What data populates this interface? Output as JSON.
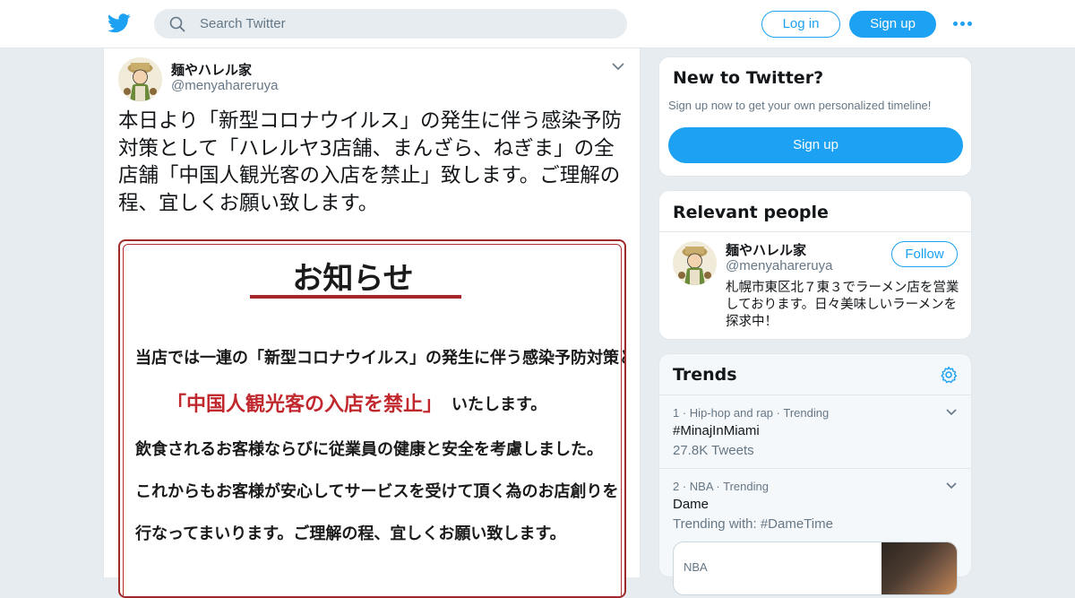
{
  "header": {
    "search_placeholder": "Search Twitter",
    "login_label": "Log in",
    "signup_label": "Sign up",
    "brand_color": "#1da1f2"
  },
  "tweet": {
    "author_name": "麺やハレル家",
    "author_handle": "@menyahareruya",
    "text": "本日より「新型コロナウイルス」の発生に伴う感染予防対策として「ハレルヤ3店舗、まんざら、ねぎま」の全店舗「中国人観光客の入店を禁止」致します。ご理解の程、宜しくお願い致します。",
    "image": {
      "title": "お知らせ",
      "line1": "当店では一連の「新型コロナウイルス」の発生に伴う感染予防対策として",
      "red_text": "「中国人観光客の入店を禁止」",
      "red_tail": "いたします。",
      "line3": "飲食されるお客様ならびに従業員の健康と安全を考慮しました。",
      "line4": "これからもお客様が安心してサービスを受けて頂く為のお店創りを",
      "line5": "行なってまいります。ご理解の程、宜しくお願い致します。"
    }
  },
  "new_to_twitter": {
    "title": "New to Twitter?",
    "subtitle": "Sign up now to get your own personalized timeline!",
    "button": "Sign up"
  },
  "relevant_people": {
    "title": "Relevant people",
    "person": {
      "name": "麺やハレル家",
      "handle": "@menyahareruya",
      "follow_label": "Follow",
      "bio": "札幌市東区北７東３でラーメン店を営業しております。日々美味しいラーメンを探求中！"
    }
  },
  "trends": {
    "title": "Trends",
    "items": [
      {
        "rank": "1",
        "category": "Hip-hop and rap",
        "status": "Trending",
        "name": "#MinajInMiami",
        "sub": "27.8K Tweets"
      },
      {
        "rank": "2",
        "category": "NBA",
        "status": "Trending",
        "name": "Dame",
        "sub": "Trending with: #DameTime"
      }
    ],
    "media_card_label": "NBA"
  }
}
